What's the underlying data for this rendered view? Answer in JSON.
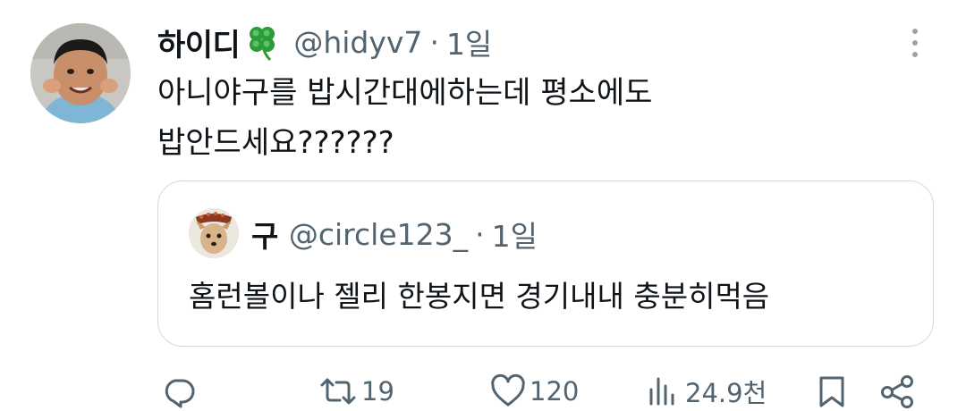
{
  "tweet": {
    "author_name": "하이디",
    "author_emoji": "four-leaf-clover-icon",
    "handle": "@hidyv7",
    "separator": "·",
    "time": "1일",
    "text": "아니야구를 밥시간대에하는데 평소에도\n밥안드세요??????"
  },
  "quote": {
    "author_name": "구",
    "handle": "@circle123_",
    "separator": "·",
    "time": "1일",
    "text": "홈런볼이나 젤리 한봉지면 경기내내 충분히먹음"
  },
  "actions": {
    "reply": {
      "icon": "reply-icon"
    },
    "retweet": {
      "icon": "retweet-icon",
      "count": "19"
    },
    "like": {
      "icon": "heart-icon",
      "count": "120"
    },
    "views": {
      "icon": "views-icon",
      "count": "24.9천"
    },
    "bookmark": {
      "icon": "bookmark-icon"
    },
    "share": {
      "icon": "share-icon"
    }
  },
  "colors": {
    "text": "#0f1419",
    "secondary": "#536471",
    "border": "#cfd9de",
    "clover": "#2e9b3a"
  }
}
